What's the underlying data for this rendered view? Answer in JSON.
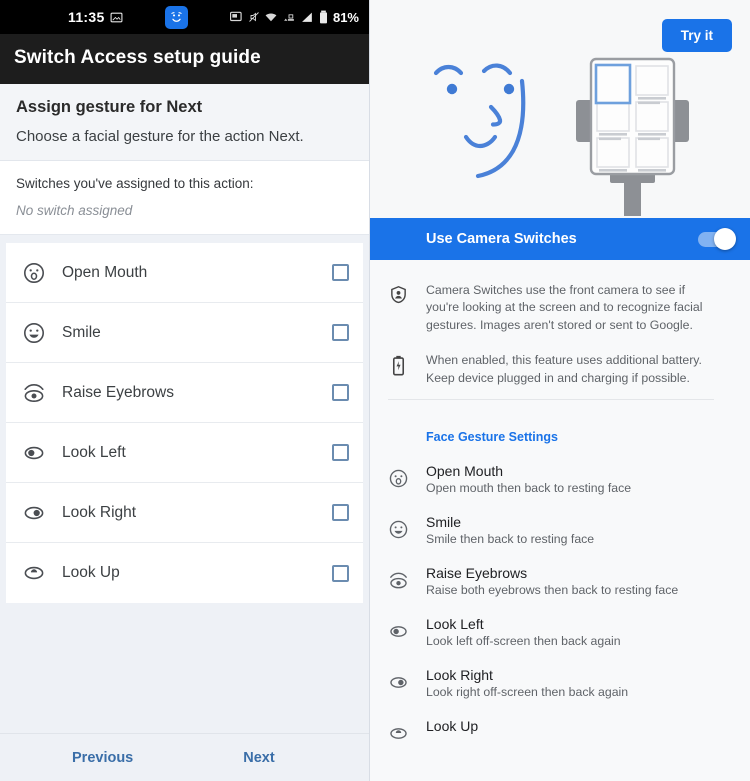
{
  "left_panel": {
    "status_bar": {
      "time": "11:35",
      "battery_percent": "81%",
      "icons": [
        "image-icon",
        "face-switch-icon",
        "screenshot-icon",
        "mute-icon",
        "wifi-icon",
        "cast-icon",
        "signal-icon",
        "battery-icon"
      ]
    },
    "app_bar": {
      "title": "Switch Access setup guide"
    },
    "section": {
      "title": "Assign gesture for Next",
      "subtitle": "Choose a facial gesture for the action Next."
    },
    "assigned": {
      "label": "Switches you've assigned to this action:",
      "value": "No switch assigned"
    },
    "gestures": [
      {
        "label": "Open Mouth",
        "icon": "open-mouth-icon",
        "checked": false
      },
      {
        "label": "Smile",
        "icon": "smile-icon",
        "checked": false
      },
      {
        "label": "Raise Eyebrows",
        "icon": "raise-eyebrows-icon",
        "checked": false
      },
      {
        "label": "Look Left",
        "icon": "look-left-icon",
        "checked": false
      },
      {
        "label": "Look Right",
        "icon": "look-right-icon",
        "checked": false
      },
      {
        "label": "Look Up",
        "icon": "look-up-icon",
        "checked": false
      }
    ],
    "footer": {
      "previous": "Previous",
      "next": "Next"
    }
  },
  "right_panel": {
    "hero": {
      "try_button": "Try it",
      "illustration": "face-and-phone-on-stand-illustration"
    },
    "camera_switches": {
      "label": "Use Camera Switches",
      "enabled": true
    },
    "info_rows": [
      {
        "icon": "privacy-shield-icon",
        "text": "Camera Switches use the front camera to see if you're looking at the screen and to recognize facial gestures. Images aren't stored or sent to Google."
      },
      {
        "icon": "battery-charging-icon",
        "text": "When enabled, this feature uses additional battery. Keep device plugged in and charging if possible."
      }
    ],
    "face_gesture_settings": {
      "title": "Face Gesture Settings",
      "items": [
        {
          "icon": "open-mouth-icon",
          "title": "Open Mouth",
          "desc": "Open mouth then back to resting face"
        },
        {
          "icon": "smile-icon",
          "title": "Smile",
          "desc": "Smile then back to resting face"
        },
        {
          "icon": "raise-eyebrows-icon",
          "title": "Raise Eyebrows",
          "desc": "Raise both eyebrows then back to resting face"
        },
        {
          "icon": "look-left-icon",
          "title": "Look Left",
          "desc": "Look left off-screen then back again"
        },
        {
          "icon": "look-right-icon",
          "title": "Look Right",
          "desc": "Look right off-screen then back again"
        },
        {
          "icon": "look-up-icon",
          "title": "Look Up",
          "desc": ""
        }
      ]
    }
  },
  "colors": {
    "accent_blue": "#1a73e8",
    "app_bar": "#1d1d1d",
    "panel_bg": "#f8f9fa",
    "link_blue": "#3a6ea8"
  }
}
